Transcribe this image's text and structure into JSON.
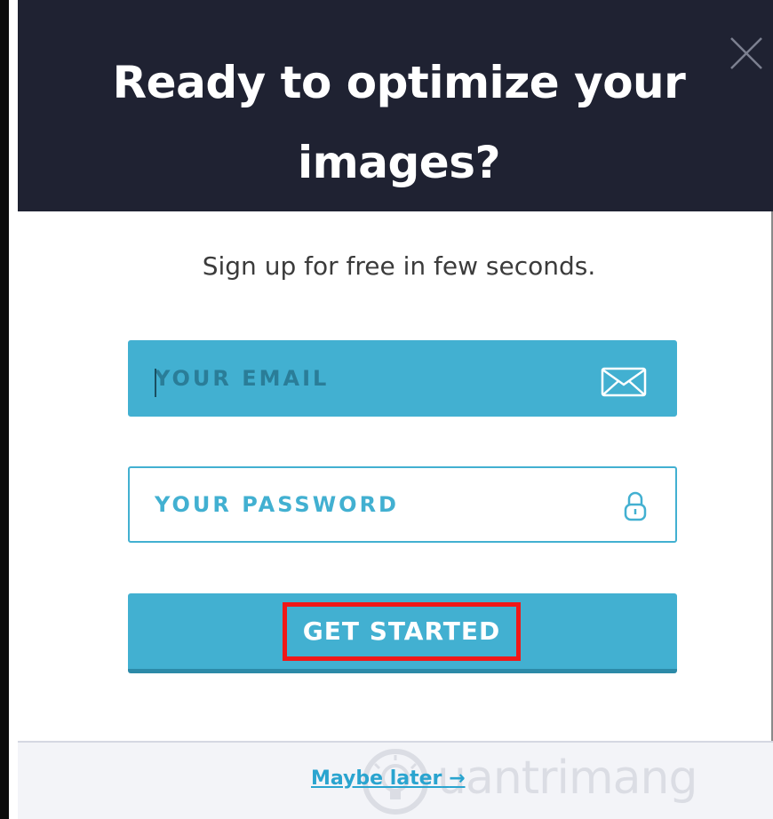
{
  "dialog": {
    "headline": "Ready to optimize your images?",
    "subtitle": "Sign up for free in few seconds."
  },
  "form": {
    "email_placeholder": "YOUR EMAIL",
    "email_value": "",
    "password_placeholder": "YOUR PASSWORD",
    "password_value": "",
    "submit_label": "GET STARTED"
  },
  "footer": {
    "later_label": "Maybe later",
    "later_arrow": "→",
    "watermark": "uantrimang"
  },
  "icons": {
    "close": "close-icon",
    "email": "envelope-icon",
    "password": "lock-icon",
    "watermark_logo": "bulb-icon"
  },
  "colors": {
    "header_bg": "#1f2232",
    "accent": "#42b0d1",
    "accent_dark": "#2c8aa8",
    "highlight_box": "#f01818",
    "link": "#2aa4cf",
    "footer_bg": "#f3f4f8"
  }
}
